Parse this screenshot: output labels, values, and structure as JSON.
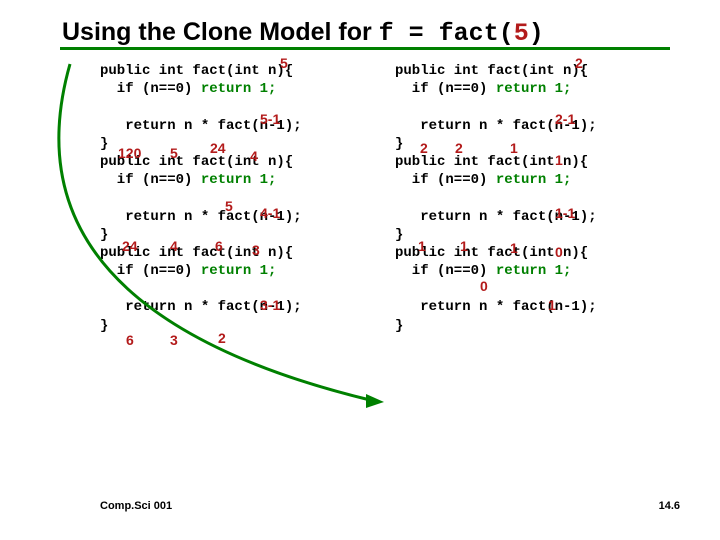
{
  "title": {
    "prefix": "Using the Clone Model for ",
    "code": "f = fact(",
    "arg": "5",
    "close": ")"
  },
  "code": {
    "sig": "public int fact(int n){",
    "base": "  if (n==0) ",
    "ret1": "return 1;",
    "rec": "   return n * fact(n-1);",
    "close": "}"
  },
  "ann": {
    "l5": "5",
    "l51": "5-1",
    "l120": "120",
    "l5b": "5",
    "l24": "24",
    "l4": "4",
    "l5c": "5",
    "l41": "4-1",
    "l24b": "24",
    "l4b": "4",
    "l6": "6",
    "l3": "3",
    "l31": "3-1",
    "l6b": "6",
    "l3b": "3",
    "l2": "2",
    "r2": "2",
    "r21": "2-1",
    "r2b": "2",
    "r2c": "2",
    "r1": "1",
    "r1b": "1",
    "r11": "1-1",
    "r1c": "1",
    "r1d": "1",
    "r1e": "1",
    "r0": "0",
    "r0b": "0",
    "r1f": "1"
  },
  "footer": {
    "left": "Comp.Sci 001",
    "right": "14.6"
  }
}
